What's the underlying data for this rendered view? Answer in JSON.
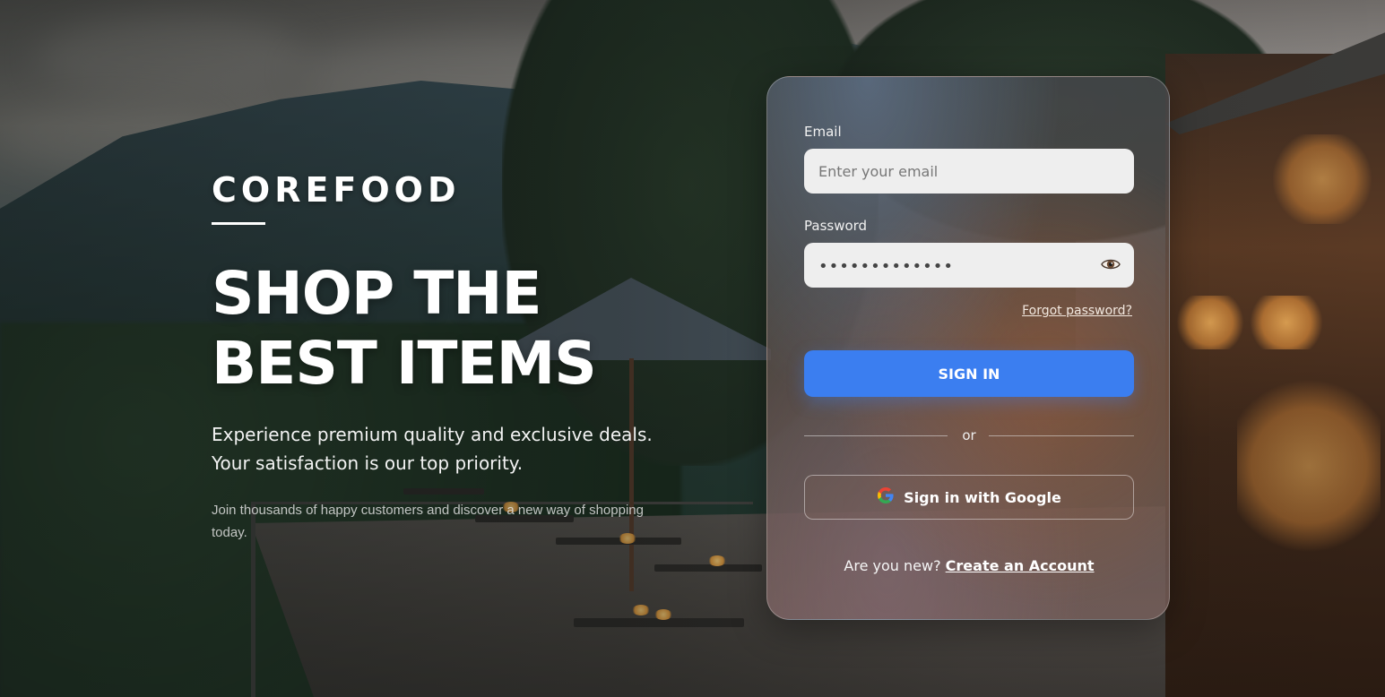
{
  "brand": {
    "name": "COREFOOD"
  },
  "hero": {
    "headline": "SHOP THE\nBEST ITEMS",
    "tagline": "Experience premium quality and exclusive deals.\nYour satisfaction is our top priority.",
    "subcopy": "Join thousands of happy customers and discover a new way of shopping today."
  },
  "login": {
    "email_label": "Email",
    "email_placeholder": "Enter your email",
    "email_value": "",
    "password_label": "Password",
    "password_mask": "•••••••••••••",
    "show_password_icon": "eye-icon",
    "forgot_password": "Forgot password?",
    "signin_button": "SIGN IN",
    "divider_text": "or",
    "google_button": "Sign in with Google",
    "google_icon": "google-icon",
    "new_prompt": "Are you new?",
    "create_account": "Create an Account"
  },
  "colors": {
    "primary_button": "#3b7ef0",
    "text_light": "#ffffff"
  }
}
